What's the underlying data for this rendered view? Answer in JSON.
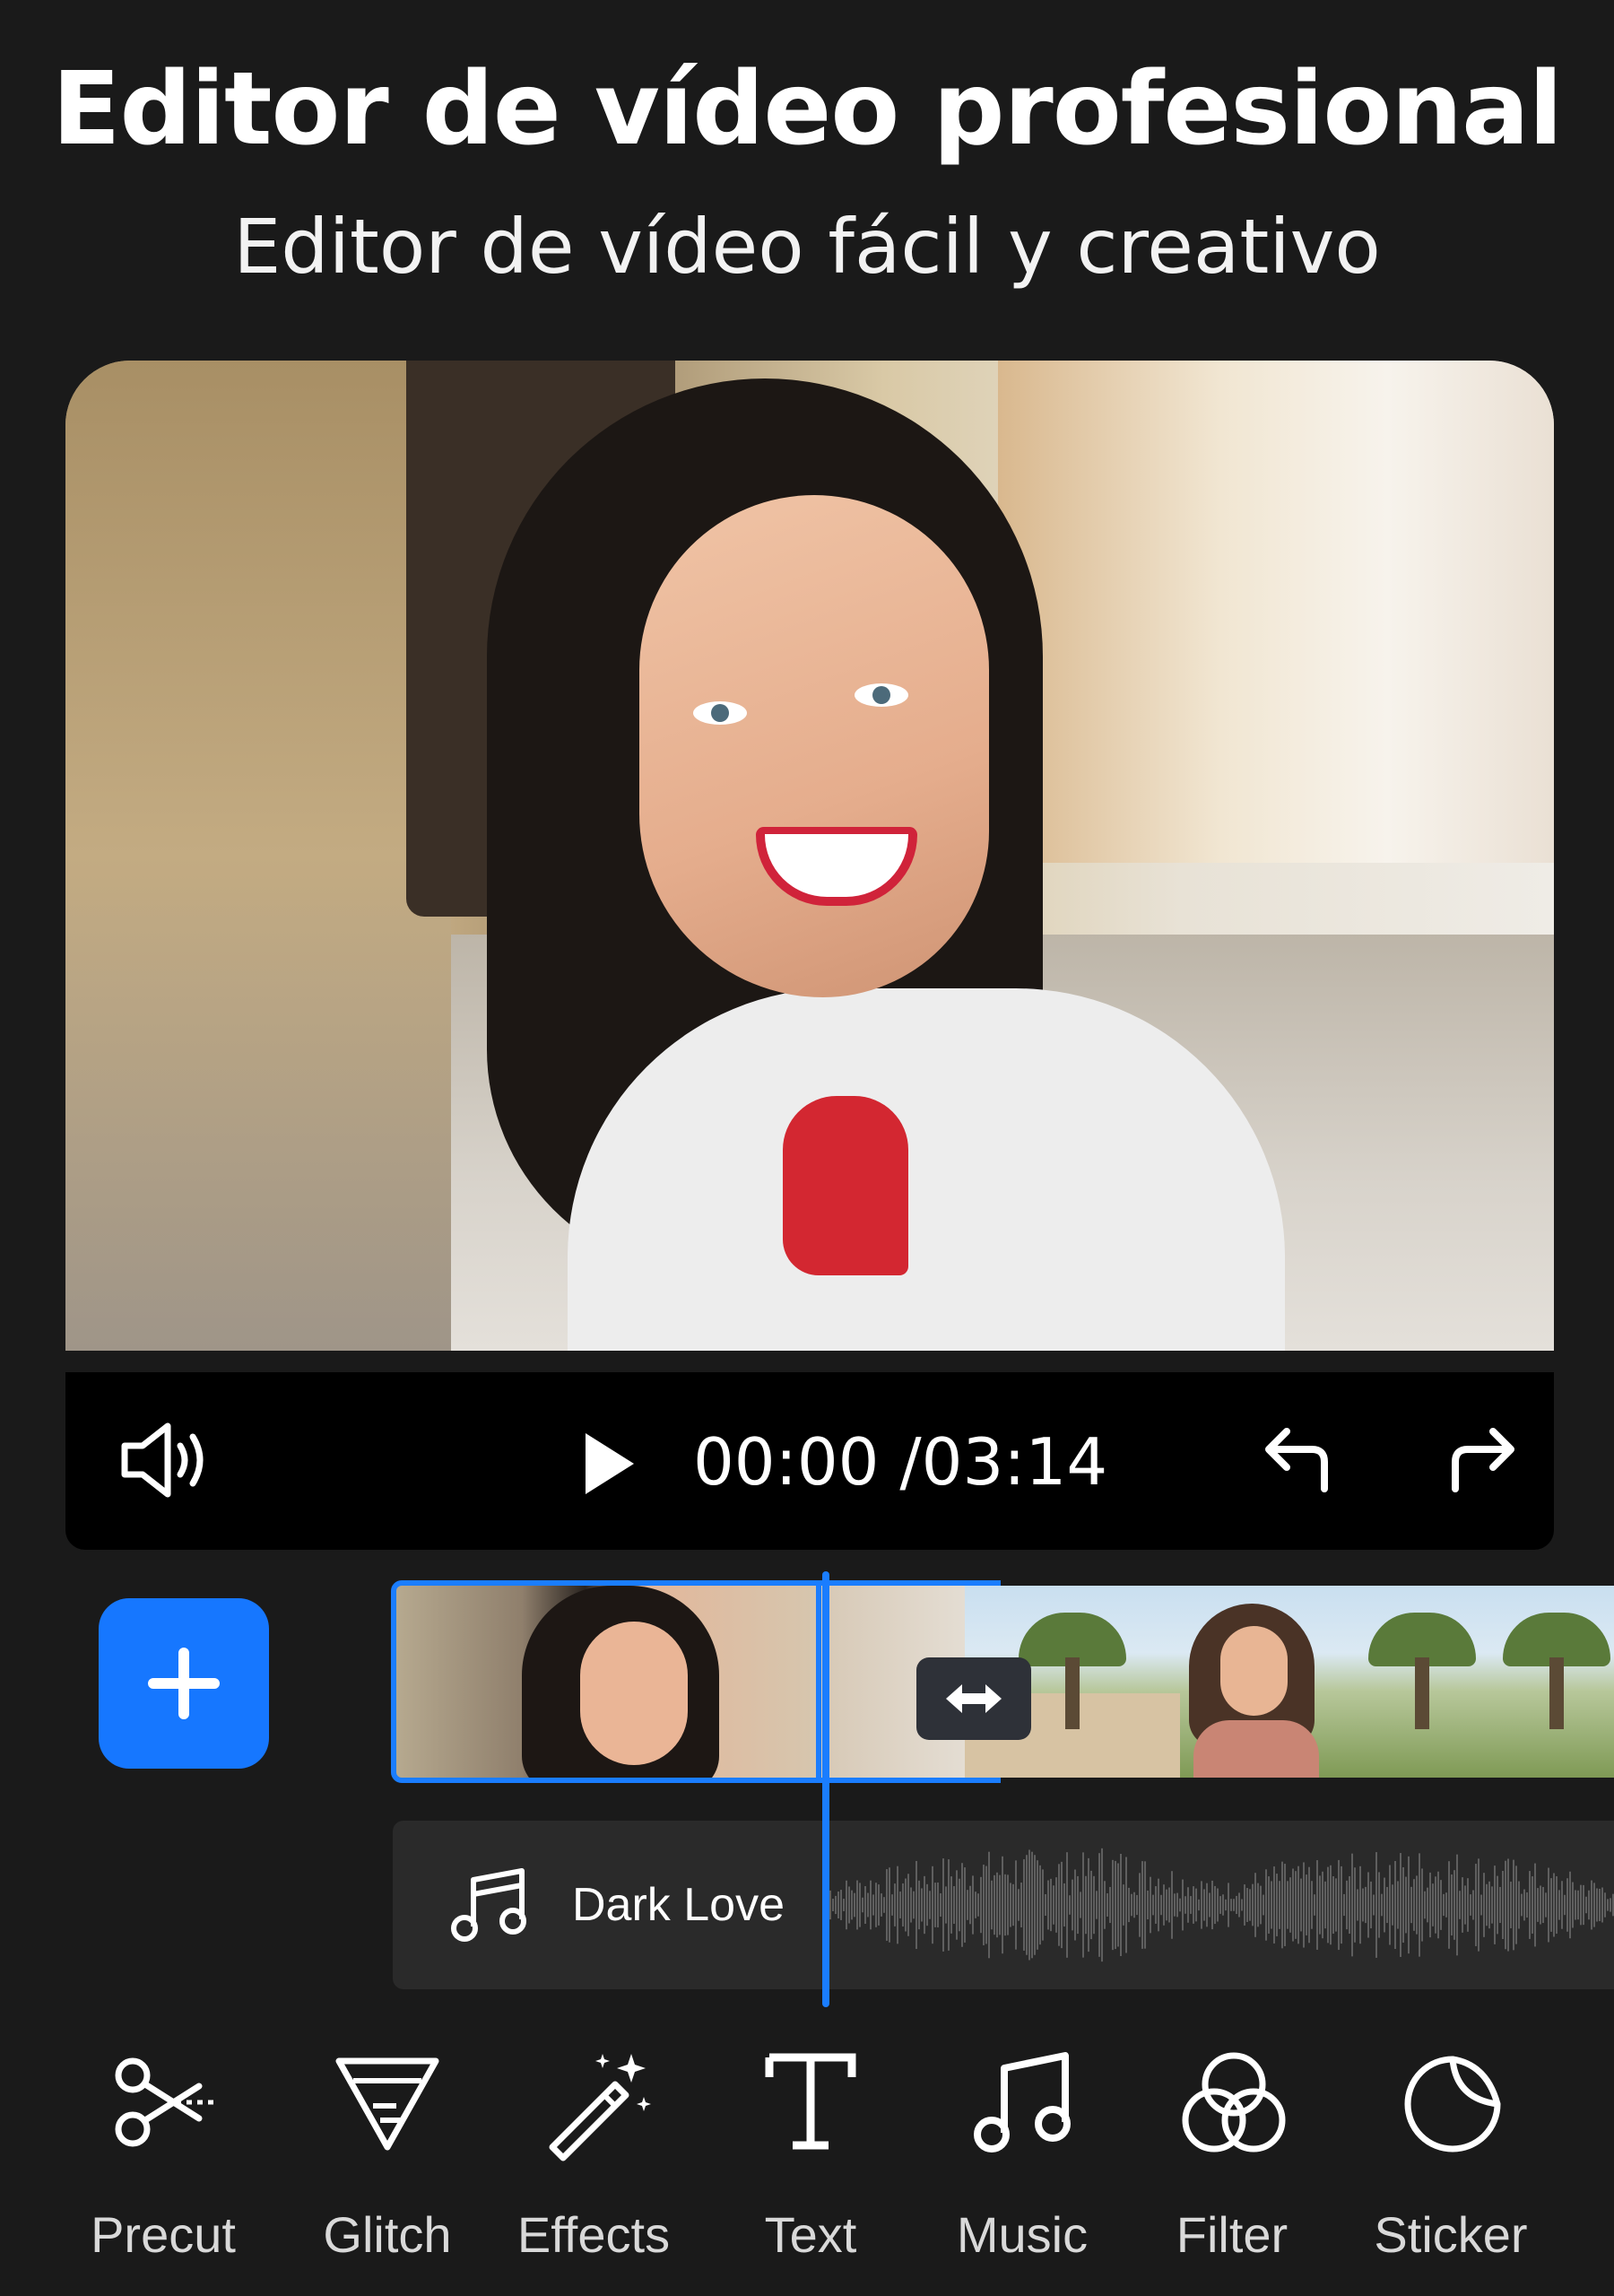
{
  "header": {
    "title": "Editor de vídeo profesional",
    "subtitle": "Editor de vídeo fácil y creativo"
  },
  "player": {
    "current_time": "00:00",
    "total_time": "/03:14",
    "icons": [
      "volume-icon",
      "play-icon",
      "undo-icon",
      "redo-icon"
    ]
  },
  "timeline": {
    "add_button_icon": "plus-icon",
    "split_handle_icon": "double-arrow-icon",
    "audio": {
      "label": "Dark Love",
      "icon": "music-note-icon"
    }
  },
  "toolbar": {
    "items": [
      {
        "label": "Precut",
        "icon": "scissors-icon"
      },
      {
        "label": "Glitch",
        "icon": "glitch-icon"
      },
      {
        "label": "Effects",
        "icon": "magic-wand-icon"
      },
      {
        "label": "Text",
        "icon": "text-icon"
      },
      {
        "label": "Music",
        "icon": "music-icon"
      },
      {
        "label": "Filter",
        "icon": "filter-icon"
      },
      {
        "label": "Sticker",
        "icon": "sticker-icon"
      }
    ]
  },
  "colors": {
    "background": "#1a1a1a",
    "accent": "#1a7dff",
    "add_button": "#1677ff"
  }
}
